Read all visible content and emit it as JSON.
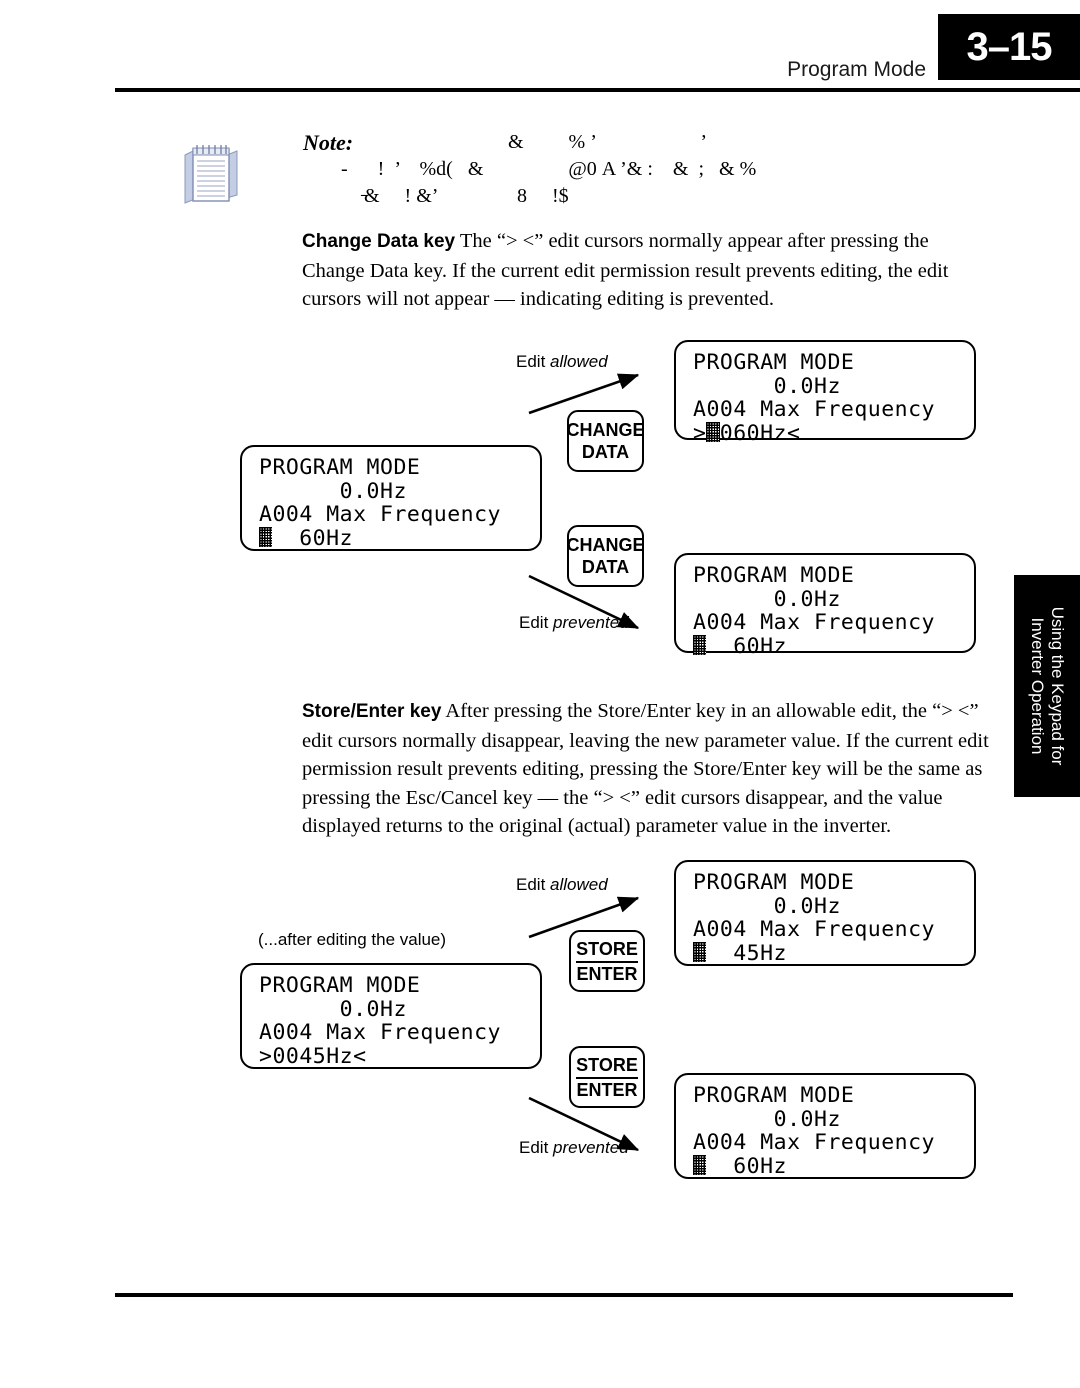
{
  "header": {
    "page_number": "3–15",
    "title": "Program Mode"
  },
  "side_tab": {
    "label": "Using the Keypad for\nInverter Operation"
  },
  "note": {
    "label": "Note:",
    "icon": "notepad-icon",
    "garbled_line_1": "&         % ’                     ’",
    "garbled_line_2": "-      !  ’    %ԁ(   &                 @0 A ’& :    &  ;   & %",
    "garbled_line_3": "̵&     ! &’                8     !$"
  },
  "paragraphs": {
    "change_data": {
      "lead": "Change Data key",
      "text": "  The “> <” edit cursors normally appear after pressing the Change Data key. If the current edit permission result prevents editing, the edit cursors will not appear — indicating editing is prevented."
    },
    "store_enter": {
      "lead": "Store/Enter key",
      "text": "  After pressing the Store/Enter key in an allowable edit, the “> <” edit cursors normally disappear, leaving the new parameter value. If the current edit permission result prevents editing, pressing the Store/Enter key will be the same as pressing the Esc/Cancel key — the “> <” edit cursors disappear, and the value displayed returns to the original (actual) parameter value in the inverter."
    }
  },
  "lcd_displays": {
    "source_1": {
      "line1": "PROGRAM MODE",
      "line2": "      0.0Hz",
      "line3": "A004 Max Frequency",
      "line4_pre": "",
      "line4_post": "  60Hz",
      "cursor": true
    },
    "allowed_1": {
      "line1": "PROGRAM MODE",
      "line2": "      0.0Hz",
      "line3": "A004 Max Frequency",
      "line4_pre": ">",
      "line4_post": "060Hz<",
      "cursor": true
    },
    "prevented_1": {
      "line1": "PROGRAM MODE",
      "line2": "      0.0Hz",
      "line3": "A004 Max Frequency",
      "line4_pre": "",
      "line4_post": "  60Hz",
      "cursor": true
    },
    "source_2": {
      "line1": "PROGRAM MODE",
      "line2": "      0.0Hz",
      "line3": "A004 Max Frequency",
      "line4_pre": ">0045Hz<",
      "line4_post": "",
      "cursor": false
    },
    "allowed_2": {
      "line1": "PROGRAM MODE",
      "line2": "      0.0Hz",
      "line3": "A004 Max Frequency",
      "line4_pre": "",
      "line4_post": "  45Hz",
      "cursor": true
    },
    "prevented_2": {
      "line1": "PROGRAM MODE",
      "line2": "      0.0Hz",
      "line3": "A004 Max Frequency",
      "line4_pre": "",
      "line4_post": "  60Hz",
      "cursor": true
    }
  },
  "keys": {
    "change_data_line1": "CHANGE",
    "change_data_line2": "DATA",
    "store_line1": "STORE",
    "store_line2": "ENTER"
  },
  "annotations": {
    "edit_word": "Edit ",
    "allowed": "allowed",
    "prevented": "prevented",
    "after_editing": "(...after editing the value)"
  },
  "colors": {
    "page_tab_bg": "#000000",
    "text": "#000000",
    "note_icon_blue": "#b9c3dd",
    "note_icon_outline": "#7a86ad"
  }
}
